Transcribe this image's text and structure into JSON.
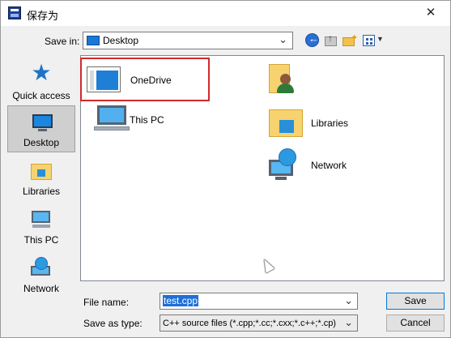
{
  "window": {
    "title": "保存为",
    "close_glyph": "✕"
  },
  "toolbar": {
    "save_in_label": "Save in:",
    "location": "Desktop",
    "icons": [
      "back-arrow-icon",
      "up-folder-icon",
      "new-folder-icon",
      "view-menu-icon"
    ]
  },
  "places": [
    {
      "label": "Quick access",
      "icon": "quick-access-star-icon",
      "selected": false
    },
    {
      "label": "Desktop",
      "icon": "desktop-monitor-icon",
      "selected": true
    },
    {
      "label": "Libraries",
      "icon": "libraries-folder-icon",
      "selected": false
    },
    {
      "label": "This PC",
      "icon": "computer-icon",
      "selected": false
    },
    {
      "label": "Network",
      "icon": "network-icon",
      "selected": false
    }
  ],
  "files": [
    {
      "name": "OneDrive",
      "icon": "onedrive-icon",
      "highlighted": true
    },
    {
      "name": "",
      "icon": "user-folder-icon"
    },
    {
      "name": "This PC",
      "icon": "computer-icon"
    },
    {
      "name": "Libraries",
      "icon": "libraries-folder-icon"
    },
    {
      "name": "Network",
      "icon": "network-icon"
    }
  ],
  "form": {
    "file_name_label": "File name:",
    "file_name_value": "test.cpp",
    "save_as_type_label": "Save as type:",
    "save_as_type_value": "C++ source files (*.cpp;*.cc;*.cxx;*.c++;*.cp)"
  },
  "buttons": {
    "save": "Save",
    "cancel": "Cancel"
  },
  "colors": {
    "highlight_border": "#d02a2a",
    "selection": "#1e6fd8",
    "accent": "#0078d7"
  }
}
